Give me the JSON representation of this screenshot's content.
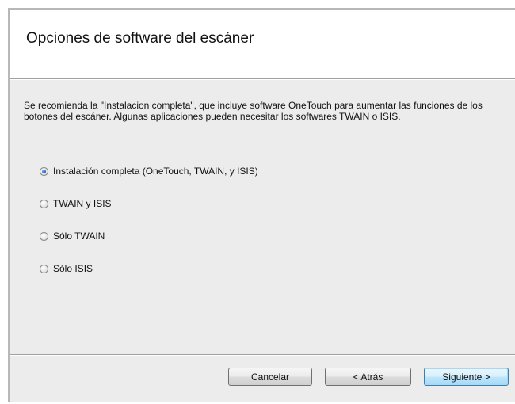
{
  "dialog": {
    "title": "Opciones de software del escáner",
    "description": "Se recomienda la \"Instalacion completa\", que incluye software OneTouch para aumentar las funciones de los botones del escáner. Algunas aplicaciones pueden necesitar los softwares TWAIN o ISIS.",
    "options": [
      {
        "label": "Instalación completa (OneTouch, TWAIN, y ISIS)",
        "selected": true
      },
      {
        "label": "TWAIN y ISIS",
        "selected": false
      },
      {
        "label": "Sólo TWAIN",
        "selected": false
      },
      {
        "label": "Sólo ISIS",
        "selected": false
      }
    ],
    "buttons": {
      "cancel": "Cancelar",
      "back": "< Atrás",
      "next": "Siguiente >"
    }
  },
  "colors": {
    "window_bg": "#ececec",
    "header_bg": "#ffffff",
    "default_button_border": "#3c7fb1",
    "radio_selected": "#1f5fb8"
  }
}
